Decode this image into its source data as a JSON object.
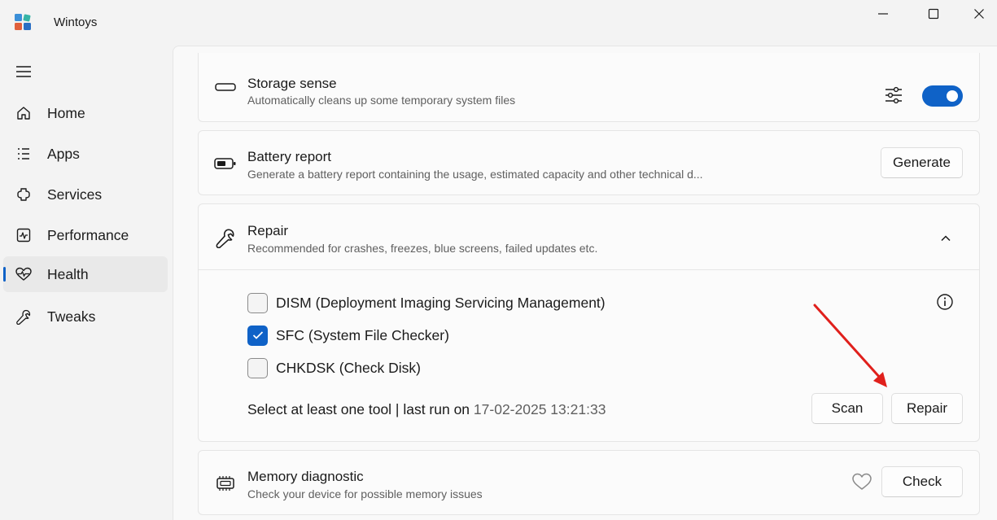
{
  "window": {
    "title": "Wintoys",
    "controls": [
      "minimize",
      "maximize",
      "close"
    ]
  },
  "sidebar": {
    "items": [
      {
        "label": "Home",
        "icon": "home-icon"
      },
      {
        "label": "Apps",
        "icon": "apps-list-icon"
      },
      {
        "label": "Services",
        "icon": "services-icon"
      },
      {
        "label": "Performance",
        "icon": "performance-icon"
      },
      {
        "label": "Health",
        "icon": "heart-pulse-icon",
        "active": true
      },
      {
        "label": "Tweaks",
        "icon": "wrench-icon"
      }
    ]
  },
  "cards": {
    "storage": {
      "title": "Storage sense",
      "description": "Automatically cleans up some temporary system files",
      "toggle_on": true
    },
    "battery": {
      "title": "Battery report",
      "description": "Generate a battery report containing the usage, estimated capacity and other technical d...",
      "button": "Generate"
    },
    "repair": {
      "title": "Repair",
      "description": "Recommended for crashes, freezes, blue screens, failed updates etc.",
      "expanded": true,
      "tools": [
        {
          "label": "DISM (Deployment Imaging Servicing Management)",
          "checked": false
        },
        {
          "label": "SFC (System File Checker)",
          "checked": true
        },
        {
          "label": "CHKDSK (Check Disk)",
          "checked": false
        }
      ],
      "status_prefix": "Select at least one tool | last run on",
      "status_time": "17-02-2025 13:21:33",
      "scan_button": "Scan",
      "repair_button": "Repair"
    },
    "memory": {
      "title": "Memory diagnostic",
      "description": "Check your device for possible memory issues",
      "button": "Check"
    }
  },
  "colors": {
    "accent": "#0f62c7",
    "annotation_arrow": "#e0201c"
  }
}
